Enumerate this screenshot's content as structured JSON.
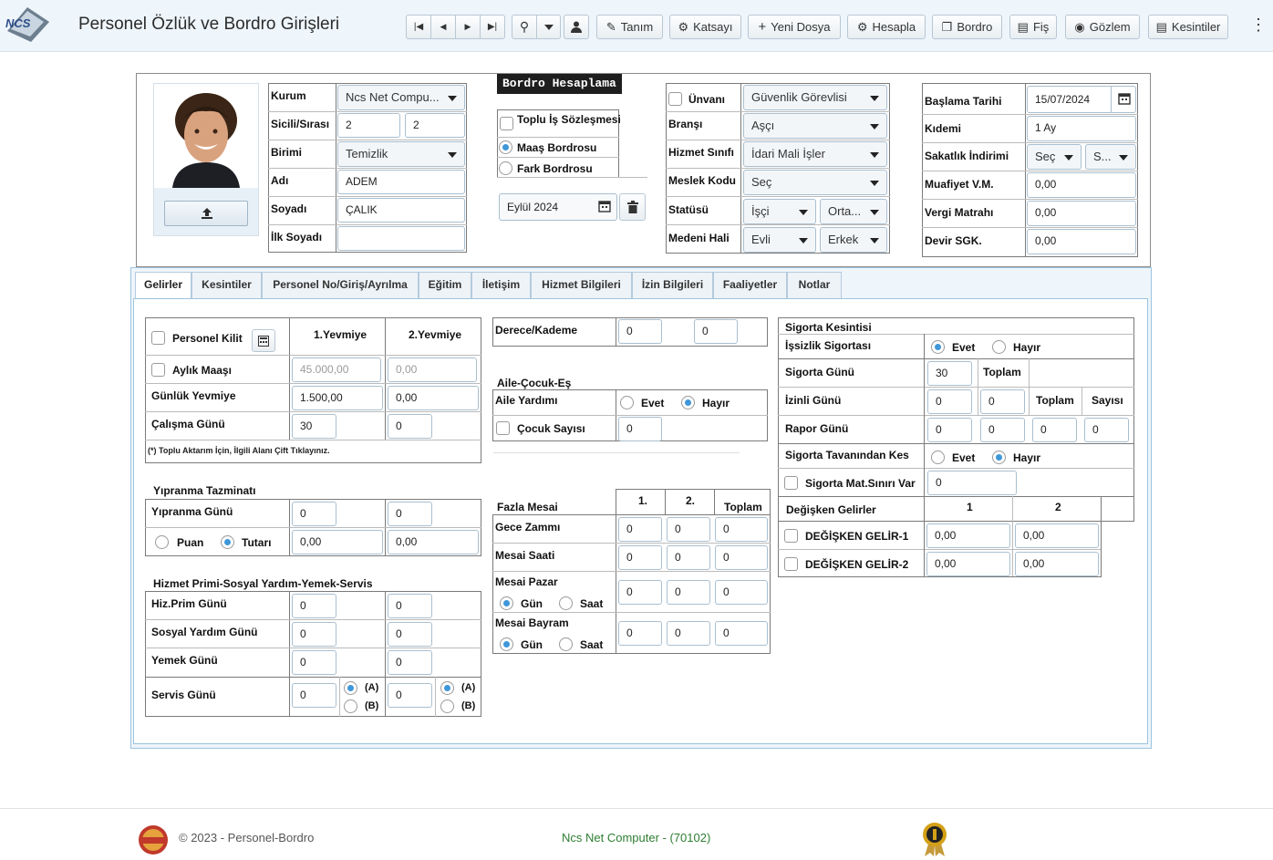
{
  "header": {
    "title": "Personel Özlük ve Bordro Girişleri",
    "logo_text": "NCS",
    "buttons": {
      "tanim": "Tanım",
      "katsayi": "Katsayı",
      "yeni_dosya": "Yeni Dosya",
      "hesapla": "Hesapla",
      "bordro": "Bordro",
      "fis": "Fiş",
      "gozlem": "Gözlem",
      "kesintiler": "Kesintiler"
    }
  },
  "person": {
    "labels": {
      "kurum": "Kurum",
      "sicil": "Sicili/Sırası",
      "birimi": "Birimi",
      "adi": "Adı",
      "soyadi": "Soyadı",
      "ilk_soyadi": "İlk Soyadı"
    },
    "kurum": "Ncs Net Compu...",
    "sicil": "2",
    "sira": "2",
    "birimi": "Temizlik",
    "adi": "ADEM",
    "soyadi": "ÇALIK",
    "ilk_soyadi": ""
  },
  "bordro_hesaplama": {
    "title": "Bordro Hesaplama",
    "toplu": "Toplu İş Sözleşmesi",
    "maas": "Maaş Bordrosu",
    "fark": "Fark Bordrosu",
    "donem": "Eylül 2024"
  },
  "job": {
    "labels": {
      "unvani": "Ünvanı",
      "bransi": "Branşı",
      "hizmet_sinifi": "Hizmet Sınıfı",
      "meslek_kodu": "Meslek Kodu",
      "statusu": "Statüsü",
      "medeni_hali": "Medeni Hali"
    },
    "unvani": "Güvenlik Görevlisi",
    "bransi": "Aşçı",
    "hizmet_sinifi": "İdari Mali İşler",
    "meslek_kodu": "Seç",
    "statusu": "İşçi",
    "statu2": "Orta...",
    "medeni_hali": "Evli",
    "cinsiyet": "Erkek"
  },
  "dates": {
    "labels": {
      "baslama": "Başlama Tarihi",
      "kidem": "Kıdemi",
      "sakatlik": "Sakatlık İndirimi",
      "muafiyet": "Muafiyet V.M.",
      "vergi": "Vergi Matrahı",
      "devir": "Devir SGK."
    },
    "baslama": "15/07/2024",
    "kidem": "1 Ay",
    "sakatlik1": "Seç",
    "sakatlik2": "S...",
    "muafiyet": "0,00",
    "vergi": "0,00",
    "devir": "0,00"
  },
  "tabs": [
    "Gelirler",
    "Kesintiler",
    "Personel No/Giriş/Ayrılma",
    "Eğitim",
    "İletişim",
    "Hizmet Bilgileri",
    "İzin Bilgileri",
    "Faaliyetler",
    "Notlar"
  ],
  "gelirler": {
    "personel_kilit": "Personel Kilit",
    "col1": "1.Yevmiye",
    "col2": "2.Yevmiye",
    "aylik_maasi": "Aylık Maaşı",
    "aylik1": "45.000,00",
    "aylik2": "0,00",
    "gunluk_yevmiye": "Günlük Yevmiye",
    "gunluk1": "1.500,00",
    "gunluk2": "0,00",
    "calisma_gunu": "Çalışma Günü",
    "calisma1": "30",
    "calisma2": "0",
    "note": "(*) Toplu Aktarım İçin, İlgili Alanı Çift Tıklayınız.",
    "yipranma_title": "Yıpranma Tazminatı",
    "yipranma_gunu": "Yıpranma Günü",
    "yip1": "0",
    "yip2": "0",
    "puan": "Puan",
    "tutari": "Tutarı",
    "tutar1": "0,00",
    "tutar2": "0,00",
    "hizmet_title": "Hizmet Primi-Sosyal Yardım-Yemek-Servis",
    "hiz_prim": "Hiz.Prim Günü",
    "hiz1": "0",
    "hiz2": "0",
    "sosyal": "Sosyal Yardım Günü",
    "sos1": "0",
    "sos2": "0",
    "yemek": "Yemek Günü",
    "yem1": "0",
    "yem2": "0",
    "servis": "Servis Günü",
    "ser1": "0",
    "ser2": "0",
    "a": "(A)",
    "b": "(B)"
  },
  "middle": {
    "derece": "Derece/Kademe",
    "derece1": "0",
    "derece2": "0",
    "aile_title": "Aile-Çocuk-Eş",
    "aile_yardimi": "Aile Yardımı",
    "evet": "Evet",
    "hayir": "Hayır",
    "cocuk": "Çocuk Sayısı",
    "cocuk_val": "0",
    "fazla_title": "Fazla Mesai",
    "c1": "1.",
    "c2": "2.",
    "toplam": "Toplam",
    "gece": "Gece Zammı",
    "mesai_saati": "Mesai Saati",
    "mesai_pazar": "Mesai Pazar",
    "mesai_bayram": "Mesai Bayram",
    "gun": "Gün",
    "saat": "Saat",
    "zero": "0"
  },
  "right": {
    "sigorta_kesintisi": "Sigorta Kesintisi",
    "issizlik": "İşsizlik Sigortası",
    "evet": "Evet",
    "hayir": "Hayır",
    "sigorta_gunu": "Sigorta Günü",
    "sigorta_gunu_val": "30",
    "toplam": "Toplam",
    "izinli": "İzinli Günü",
    "sayisi": "Sayısı",
    "rapor": "Rapor Günü",
    "tavan": "Sigorta Tavanından Kes",
    "mat_siniri": "Sigorta Mat.Sınırı Var",
    "mat_val": "0",
    "degisken": "Değişken Gelirler",
    "d1": "1",
    "d2": "2",
    "gelir1": "DEĞİŞKEN GELİR-1",
    "gelir2": "DEĞİŞKEN GELİR-2",
    "money": "0,00",
    "zero": "0"
  },
  "footer": {
    "copyright": "© 2023 - Personel-Bordro",
    "company": "Ncs Net Computer - (70102)"
  },
  "colors": {
    "accent": "#3f97d9",
    "header_bg": "#eef5fb",
    "footer_company": "#2e7d32"
  }
}
